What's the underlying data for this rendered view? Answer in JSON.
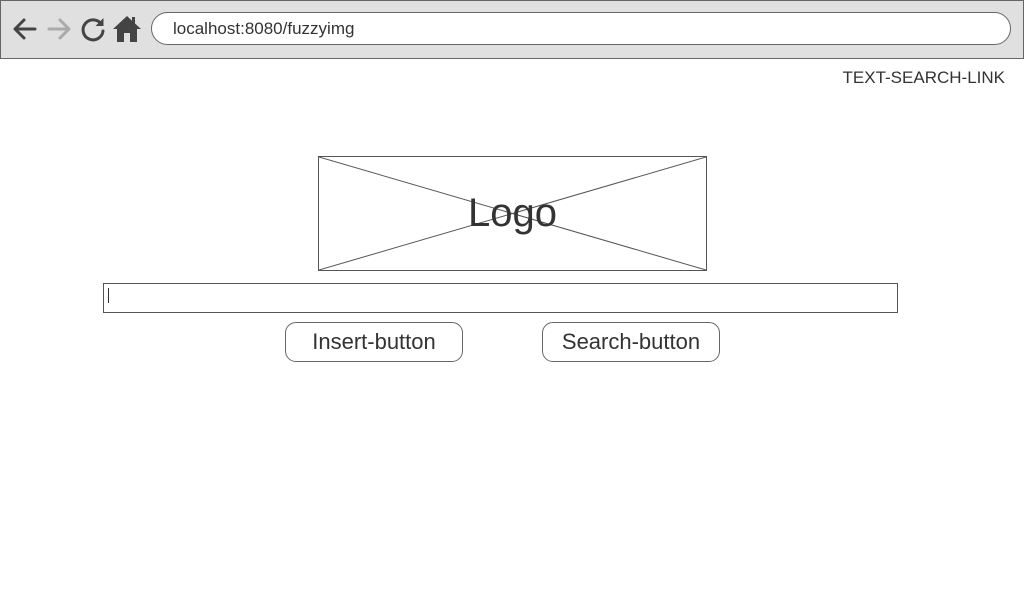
{
  "browser": {
    "url": "localhost:8080/fuzzyimg",
    "icons": {
      "back": "arrow-left-icon",
      "forward": "arrow-right-icon",
      "reload": "reload-icon",
      "home": "home-icon"
    },
    "colors": {
      "active_icon": "#444444",
      "disabled_icon": "#aaaaaa",
      "toolbar_bg": "#e0e0e0"
    }
  },
  "header": {
    "text_search_link": "TEXT-SEARCH-LINK"
  },
  "logo": {
    "label": "Logo"
  },
  "search": {
    "value": "",
    "placeholder": ""
  },
  "buttons": {
    "insert_label": "Insert-button",
    "search_label": "Search-button"
  }
}
